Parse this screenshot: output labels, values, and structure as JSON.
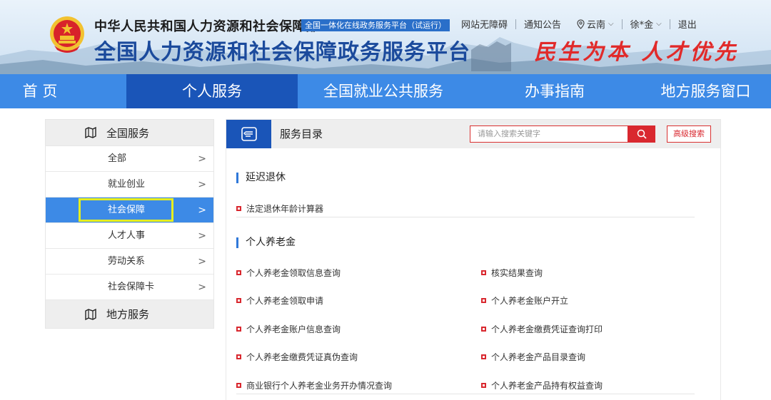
{
  "header": {
    "org_name": "中华人民共和国人力资源和社会保障部",
    "org_tag": "全国一体化在线政务服务平台（试运行）",
    "site_title": "全国人力资源和社会保障政务服务平台",
    "slogan": "民生为本 人才优先",
    "links": {
      "accessibility": "网站无障碍",
      "notice": "通知公告",
      "region": "云南",
      "user": "徐*金",
      "logout": "退出"
    }
  },
  "nav": {
    "items": [
      "首 页",
      "个人服务",
      "全国就业公共服务",
      "办事指南",
      "地方服务窗口"
    ],
    "active": "个人服务"
  },
  "sidebar": {
    "head": "全国服务",
    "items": [
      "全部",
      "就业创业",
      "社会保障",
      "人才人事",
      "劳动关系",
      "社会保障卡"
    ],
    "active": "社会保障",
    "foot": "地方服务"
  },
  "main": {
    "head_title": "服务目录",
    "search_placeholder": "请输入搜索关键字",
    "adv_search": "高级搜索",
    "sections": [
      {
        "title": "延迟退休",
        "items": [
          "法定退休年龄计算器"
        ]
      },
      {
        "title": "个人养老金",
        "items": [
          "个人养老金领取信息查询",
          "核实结果查询",
          "个人养老金领取申请",
          "个人养老金账户开立",
          "个人养老金账户信息查询",
          "个人养老金缴费凭证查询打印",
          "个人养老金缴费凭证真伪查询",
          "个人养老金产品目录查询",
          "商业银行个人养老金业务开办情况查询",
          "个人养老金产品持有权益查询"
        ]
      }
    ]
  },
  "colors": {
    "nav_blue": "#3d8ae6",
    "nav_active": "#1a55b8",
    "accent_red": "#d9282f",
    "highlight_yellow": "#e6ee1f"
  }
}
